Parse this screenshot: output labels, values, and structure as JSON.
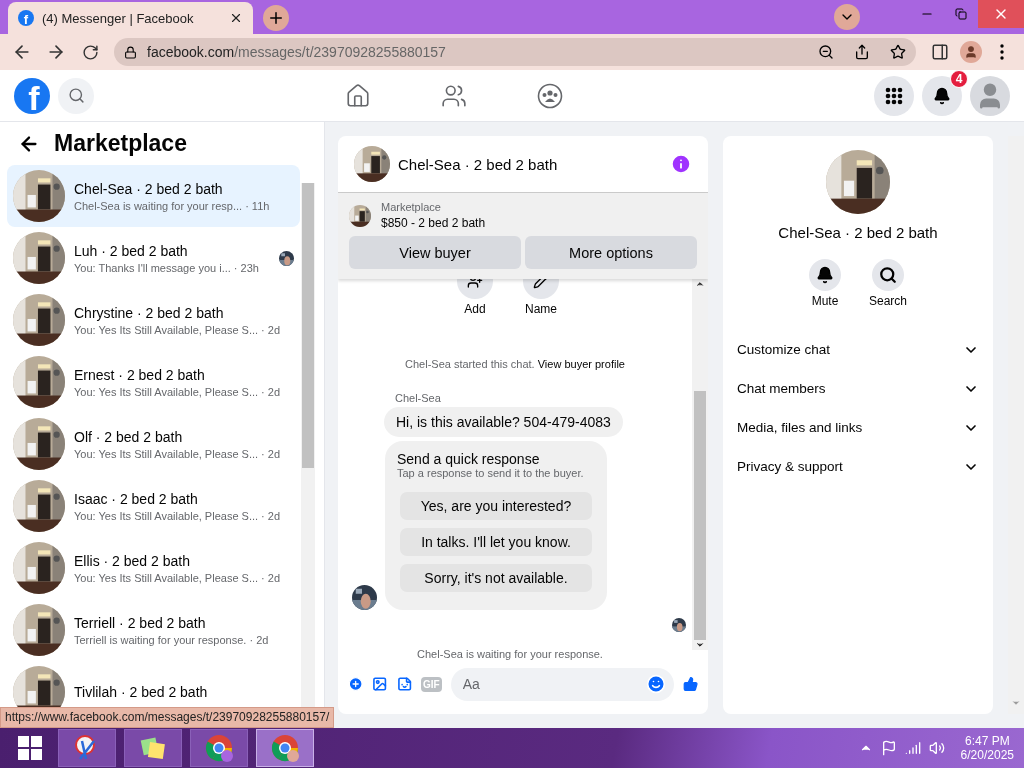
{
  "browser": {
    "favicon": "f",
    "tab_title": "(4) Messenger | Facebook",
    "url_host": "facebook.com",
    "url_path": "/messages/t/23970928255880157",
    "status_url": "https://www.facebook.com/messages/t/23970928255880157/"
  },
  "top_nav": {
    "logo": "f",
    "notification_count": "4"
  },
  "sidebar": {
    "title": "Marketplace",
    "conversations": [
      {
        "title": "Chel-Sea · 2 bed 2 bath",
        "preview": "Chel-Sea is waiting for your resp...",
        "time": "· 11h",
        "selected": true,
        "seen": false
      },
      {
        "title": "Luh · 2 bed 2 bath",
        "preview": "You: Thanks I'll message you i...",
        "time": "· 23h",
        "selected": false,
        "seen": true
      },
      {
        "title": "Chrystine · 2 bed 2 bath",
        "preview": "You: Yes Its Still Available, Please S...",
        "time": "· 2d",
        "selected": false,
        "seen": false
      },
      {
        "title": "Ernest · 2 bed 2 bath",
        "preview": "You: Yes Its Still Available, Please S...",
        "time": "· 2d",
        "selected": false,
        "seen": false
      },
      {
        "title": "Olf · 2 bed 2 bath",
        "preview": "You: Yes Its Still Available, Please S...",
        "time": "· 2d",
        "selected": false,
        "seen": false
      },
      {
        "title": "Isaac · 2 bed 2 bath",
        "preview": "You: Yes Its Still Available, Please S...",
        "time": "· 2d",
        "selected": false,
        "seen": false
      },
      {
        "title": "Ellis · 2 bed 2 bath",
        "preview": "You: Yes Its Still Available, Please S...",
        "time": "· 2d",
        "selected": false,
        "seen": false
      },
      {
        "title": "Terriell · 2 bed 2 bath",
        "preview": "Terriell is waiting for your response.",
        "time": "· 2d",
        "selected": false,
        "seen": false
      },
      {
        "title": "Tivlilah · 2 bed 2 bath",
        "selected": false,
        "seen": false
      }
    ]
  },
  "chat": {
    "title": "Chel-Sea · 2 bed 2 bath",
    "listing": {
      "label": "Marketplace",
      "name": "$850 - 2 bed 2 bath"
    },
    "buttons": [
      "View buyer",
      "More options"
    ],
    "actions": [
      {
        "kind": "add",
        "label": "Add"
      },
      {
        "kind": "name",
        "label": "Name"
      }
    ],
    "started_text": "Chel-Sea started this chat.",
    "started_link": "View buyer profile",
    "sender": "Chel-Sea",
    "message": "Hi, is this available? 504-479-4083",
    "quick_response": {
      "title": "Send a quick response",
      "subtitle": "Tap a response to send it to the buyer.",
      "options": [
        "Yes, are you interested?",
        "In talks. I'll let you know.",
        "Sorry, it's not available."
      ]
    },
    "waiting_text": "Chel-Sea is waiting for your response.",
    "gif_label": "GIF",
    "composer_placeholder": "Aa"
  },
  "info": {
    "title": "Chel-Sea · 2 bed 2 bath",
    "actions": [
      {
        "kind": "mute",
        "label": "Mute"
      },
      {
        "kind": "search",
        "label": "Search"
      }
    ],
    "sections": [
      {
        "label": "Customize chat",
        "expanded": false
      },
      {
        "label": "Chat members",
        "expanded": false
      },
      {
        "label": "Media, files and links",
        "expanded": false
      },
      {
        "label": "Privacy & support",
        "expanded": false
      }
    ]
  },
  "taskbar": {
    "apps": [
      {
        "kind": "snip",
        "selected": false
      },
      {
        "kind": "notes",
        "selected": false
      },
      {
        "kind": "chrome",
        "selected": false
      },
      {
        "kind": "chrome-profile",
        "selected": true
      }
    ],
    "time": "6:47 PM",
    "date": "6/20/2025"
  }
}
